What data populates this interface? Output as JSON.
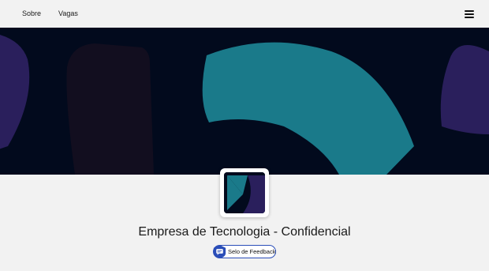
{
  "nav": {
    "links": [
      "Sobre",
      "Vagas"
    ],
    "menu_icon": "hamburger-menu-icon"
  },
  "banner": {
    "background": "#020a1d",
    "shape_colors": [
      "#1a7a8a",
      "#2a1f5c",
      "#120e1f"
    ]
  },
  "company": {
    "name": "Empresa de Tecnologia - Confidencial",
    "logo_colors": [
      "#020a1d",
      "#1a7a8a",
      "#2a1f5c"
    ]
  },
  "badge": {
    "label": "Selo de Feedback",
    "icon": "feedback-badge-icon",
    "color": "#2a4db8"
  }
}
